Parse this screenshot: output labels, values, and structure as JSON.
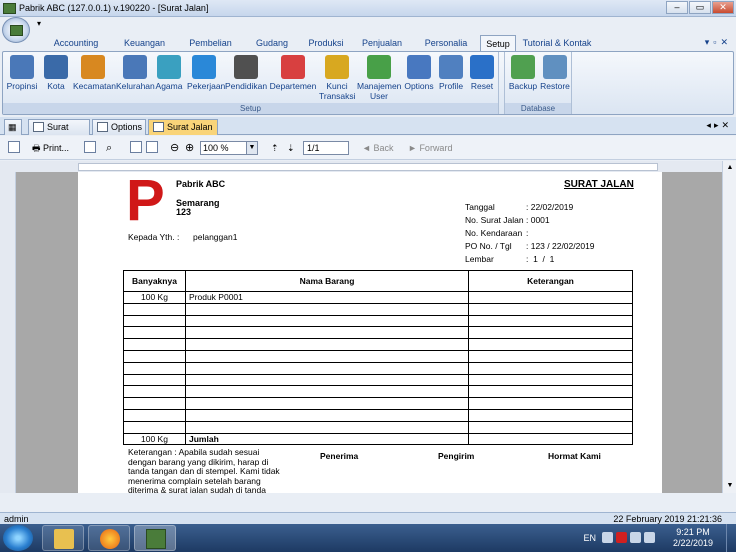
{
  "window": {
    "title": "Pabrik ABC (127.0.0.1) v.190220 - [Surat Jalan]"
  },
  "ribbon_tabs": [
    "Accounting",
    "Keuangan",
    "Pembelian",
    "Gudang",
    "Produksi",
    "Penjualan",
    "Personalia",
    "Setup",
    "Tutorial & Kontak"
  ],
  "active_tab": "Setup",
  "setup_buttons": [
    {
      "label": "Propinsi",
      "icon": "building-icon",
      "color": "#4a78b8"
    },
    {
      "label": "Kota",
      "icon": "city-icon",
      "color": "#3a6aa8"
    },
    {
      "label": "Kecamatan",
      "icon": "district-icon",
      "color": "#d88820"
    },
    {
      "label": "Kelurahan",
      "icon": "village-icon",
      "color": "#4a78b8"
    },
    {
      "label": "Agama",
      "icon": "people-icon",
      "color": "#3aa0c0"
    },
    {
      "label": "Pekerjaan",
      "icon": "briefcase-icon",
      "color": "#2a88d8"
    },
    {
      "label": "Pendidikan",
      "icon": "education-icon",
      "color": "#505050"
    },
    {
      "label": "Departemen",
      "icon": "department-icon",
      "color": "#d84040"
    },
    {
      "label": "Kunci\nTransaksi",
      "icon": "lock-icon",
      "color": "#d8a820"
    },
    {
      "label": "Manajemen\nUser",
      "icon": "user-management-icon",
      "color": "#48a048"
    },
    {
      "label": "Options",
      "icon": "tools-icon",
      "color": "#4878c0"
    },
    {
      "label": "Profile",
      "icon": "profile-icon",
      "color": "#5080c0"
    },
    {
      "label": "Reset",
      "icon": "reset-icon",
      "color": "#2a70c8"
    }
  ],
  "setup_group_label": "Setup",
  "database_buttons": [
    {
      "label": "Backup",
      "icon": "backup-icon",
      "color": "#50a050"
    },
    {
      "label": "Restore",
      "icon": "restore-icon",
      "color": "#6090c0"
    }
  ],
  "database_group_label": "Database",
  "doc_tabs": [
    "Surat Jalan",
    "Options",
    "Surat Jalan"
  ],
  "toolbar": {
    "print_label": "Print...",
    "zoom": "100 %",
    "page": "1/1",
    "back_label": "Back",
    "forward_label": "Forward"
  },
  "report": {
    "logo_letter": "P",
    "company_name": "Pabrik ABC",
    "city": "Semarang",
    "address_number": "123",
    "recipient_label": "Kepada Yth. :",
    "recipient_value": "pelanggan1",
    "title": "SURAT JALAN",
    "meta": [
      {
        "label": "Tanggal",
        "value": ": 22/02/2019"
      },
      {
        "label": "No. Surat Jalan",
        "value": ": 0001"
      },
      {
        "label": "No. Kendaraan",
        "value": ":"
      },
      {
        "label": "PO No. / Tgl",
        "value": ": 123 / 22/02/2019"
      },
      {
        "label": "Lembar",
        "value": ":  1  /  1"
      }
    ],
    "columns": [
      "Banyaknya",
      "Nama Barang",
      "Keterangan"
    ],
    "rows": [
      {
        "qty": "100 Kg",
        "name": "Produk P0001",
        "note": ""
      }
    ],
    "empty_rows": 11,
    "total_qty": "100 Kg",
    "total_label": "Jumlah",
    "footnote_lines": [
      "Keterangan : Apabila sudah sesuai",
      "dengan barang yang dikirim, harap di",
      "tanda tangan dan di stempel. Kami tidak",
      "menerima complain setelah barang",
      "diterima & surat jalan sudah di tanda"
    ],
    "signatures": [
      "Penerima",
      "Pengirim",
      "Hormat Kami"
    ]
  },
  "status": {
    "user": "admin",
    "datetime": "22 February 2019  21:21:36"
  },
  "taskbar": {
    "lang": "EN",
    "time": "9:21 PM",
    "date": "2/22/2019"
  }
}
